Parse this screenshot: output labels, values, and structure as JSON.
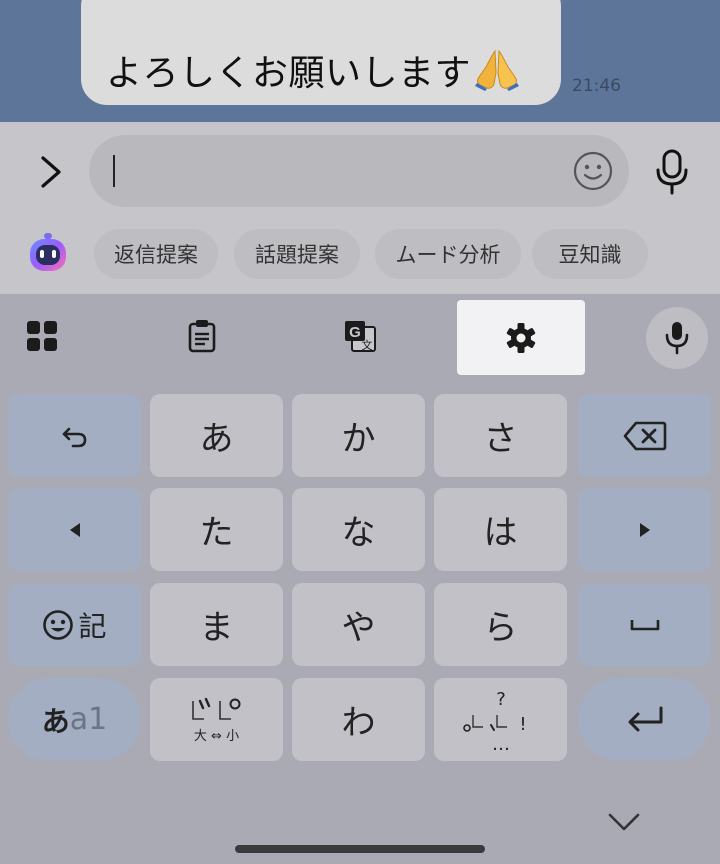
{
  "chat": {
    "message": "よろしくお願いします",
    "message_emoji": "folded-hands",
    "timestamp": "21:46"
  },
  "input": {
    "placeholder": "",
    "value": ""
  },
  "suggestions": {
    "chips": [
      "返信提案",
      "話題提案",
      "ムード分析",
      "豆知識"
    ]
  },
  "keyboard": {
    "toolbar": [
      "grid-icon",
      "clipboard-icon",
      "translate-icon",
      "gear-icon",
      "mic-icon"
    ],
    "rows": [
      [
        "undo-icon",
        "あ",
        "か",
        "さ",
        "backspace-icon"
      ],
      [
        "left-arrow-icon",
        "た",
        "な",
        "は",
        "right-arrow-icon"
      ],
      [
        "emoji-記",
        "ま",
        "や",
        "ら",
        "space-icon"
      ],
      [
        "あa1",
        "゛゜大⇔小",
        "わ",
        "。、?!…",
        "enter-icon"
      ]
    ],
    "emoji_key_label": "記",
    "mode_key_kana": "あ",
    "mode_key_alnum": "a1",
    "dakuten_sub_label": "大 ⇔ 小",
    "punct_marks": "?",
    "punct_bang": "!",
    "punct_dots": "…"
  },
  "colors": {
    "chat_bg": "#5d7598",
    "bubble_bg": "#dcdcdc",
    "keyboard_bg": "#aaaab4",
    "key_main": "#c1c1c7",
    "key_side": "#a3aec2",
    "highlight": "#f2f2f4"
  }
}
